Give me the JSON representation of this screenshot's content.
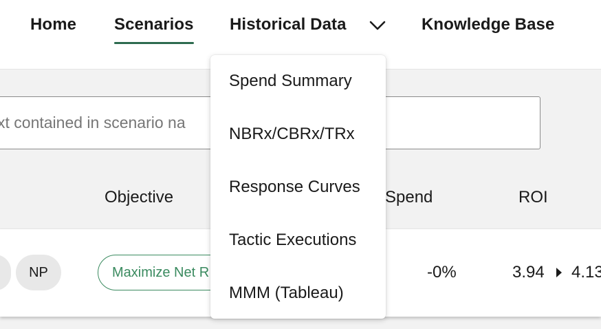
{
  "nav": {
    "home": "Home",
    "scenarios": "Scenarios",
    "historical_data": "Historical Data",
    "knowledge_base": "Knowledge Base",
    "active_tab": "Scenarios",
    "dropdown_icon": "chevron-down-icon"
  },
  "historical_menu": {
    "items": [
      "Spend Summary",
      "NBRx/CBRx/TRx",
      "Response Curves",
      "Tactic Executions",
      "MMM (Tableau)"
    ]
  },
  "search": {
    "placeholder": "xt contained in scenario na"
  },
  "table": {
    "headers": {
      "objective": "Objective",
      "spend": "Spend",
      "roi": "ROI"
    },
    "rows": [
      {
        "tags": [
          "",
          "NP"
        ],
        "objective": "Maximize Net R",
        "spend": "-0%",
        "roi_from": "3.94",
        "roi_to": "4.13",
        "roi_arrow_icon": "triangle-right-icon"
      }
    ]
  },
  "colors": {
    "accent": "#2e6b4f",
    "objective_pill": "#3a8a5f",
    "page_background": "#f2f2f2",
    "chip_background": "#e8e8e8"
  }
}
